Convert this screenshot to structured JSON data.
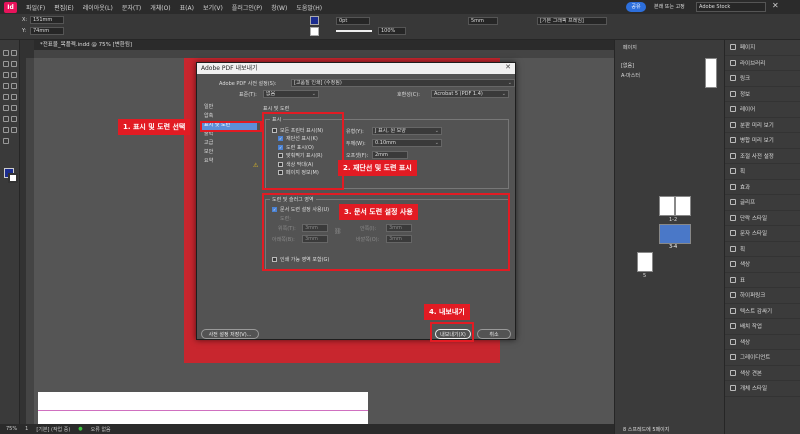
{
  "app": {
    "logo": "Id",
    "share": "공유",
    "workspace": "본래 또는 고정",
    "search_placeholder": "Adobe Stock"
  },
  "menu": [
    "파일(F)",
    "편집(E)",
    "레이아웃(L)",
    "문자(T)",
    "개체(O)",
    "표(A)",
    "보기(V)",
    "플러그인(P)",
    "창(W)",
    "도움말(H)"
  ],
  "control": {
    "x": "151mm",
    "y": "74mm",
    "stroke_weight": "0pt",
    "gap": "5mm",
    "opacity": "100%",
    "frame_style": "[기본 그래픽 프레임]"
  },
  "document_tab": "*전표물_목플젝.indd @ 75% [변환됨]",
  "status": {
    "zoom": "75%",
    "page": "1",
    "master": "[기본] (작업 중)",
    "errors": "오류 없음"
  },
  "pages_panel": {
    "title": "페이지",
    "none": "[없음]",
    "master": "A-마스터",
    "spread_label_1": "1-2",
    "spread_label_2": "3-4",
    "spread_label_3": "5",
    "footer": "8 스프레드에 5페이지"
  },
  "right_panel": [
    {
      "icon": "pages-icon",
      "label": "페이지"
    },
    {
      "icon": "cc-libraries-icon",
      "label": "라이브러리"
    },
    {
      "icon": "link-icon",
      "label": "링크"
    },
    {
      "icon": "info-icon",
      "label": "정보"
    },
    {
      "icon": "layers-icon",
      "label": "레이어"
    },
    {
      "icon": "preview-icon",
      "label": "분판 미리 보기"
    },
    {
      "icon": "flattener-icon",
      "label": "병합 미리 보기"
    },
    {
      "icon": "trap-icon",
      "label": "조절 사전 설정"
    },
    {
      "icon": "stroke-icon",
      "label": "획"
    },
    {
      "icon": "fx-icon",
      "label": "효과"
    },
    {
      "icon": "glyphs-icon",
      "label": "글리프"
    },
    {
      "icon": "char-style-icon",
      "label": "단락 스타일"
    },
    {
      "icon": "para-style-icon",
      "label": "문자 스타일"
    },
    {
      "icon": "stroke2-icon",
      "label": "획"
    },
    {
      "icon": "swatch-icon",
      "label": "색상"
    },
    {
      "icon": "table-icon",
      "label": "표"
    },
    {
      "icon": "hyperlink-icon",
      "label": "하이퍼링크"
    },
    {
      "icon": "textwrap-icon",
      "label": "텍스트 감싸기"
    },
    {
      "icon": "align-icon",
      "label": "배치 작업"
    },
    {
      "icon": "color-icon",
      "label": "색상"
    },
    {
      "icon": "gradient-icon",
      "label": "그레이디언트"
    },
    {
      "icon": "swatches-icon",
      "label": "색상 견본"
    },
    {
      "icon": "object-style-icon",
      "label": "개체 스타일"
    }
  ],
  "dialog": {
    "title": "Adobe PDF 내보내기",
    "preset_label": "Adobe PDF 사전 설정(S):",
    "preset_value": "[고품질 인쇄] (수정됨)",
    "standard_label": "표준(T):",
    "standard_value": "없음",
    "compat_label": "호환성(C):",
    "compat_value": "Acrobat 5 (PDF 1.4)",
    "sidebar": [
      "일반",
      "압축",
      "표시 및 도련",
      "출력",
      "고급",
      "보안",
      "요약"
    ],
    "section_title": "표시 및 도련",
    "marks_group": "표시",
    "all_marks": "모든 프린터 표시(N)",
    "marks": [
      {
        "label": "재단선 표시(K)",
        "checked": true
      },
      {
        "label": "도련 표시(O)",
        "checked": true
      },
      {
        "label": "맞춰찍기 표시(R)",
        "checked": false
      },
      {
        "label": "색상 막대(A)",
        "checked": false
      },
      {
        "label": "페이지 정보(M)",
        "checked": false
      }
    ],
    "type_label": "유형(Y):",
    "type_value": "J 표시, 원 모양",
    "weight_label": "두께(W):",
    "weight_value": "0.10mm",
    "offset_label": "오프셋(F):",
    "offset_value": "2mm",
    "bleed_group": "도련 및 슬러그 영역",
    "use_doc_bleed": "문서 도련 설정 사용(U)",
    "bleed_sub": "도련:",
    "top_label": "위쪽(T):",
    "top_value": "3mm",
    "bottom_label": "아래쪽(B):",
    "bottom_value": "3mm",
    "inside_label": "안쪽(I):",
    "inside_value": "3mm",
    "outside_label": "바깥쪽(O):",
    "outside_value": "3mm",
    "include_slug": "인쇄 가능 영역 포함(G)",
    "save_preset": "사전 설정 저장(V)...",
    "export": "내보내기(X)",
    "cancel": "취소"
  },
  "callouts": [
    "1. 표시 및 도련 선택",
    "2. 재단선 및 도련 표시",
    "3. 문서 도련 설정 사용",
    "4. 내보내기"
  ],
  "colors": {
    "accent": "#e21b23",
    "selection": "#5d8fd9",
    "brand": "#e8135b"
  }
}
